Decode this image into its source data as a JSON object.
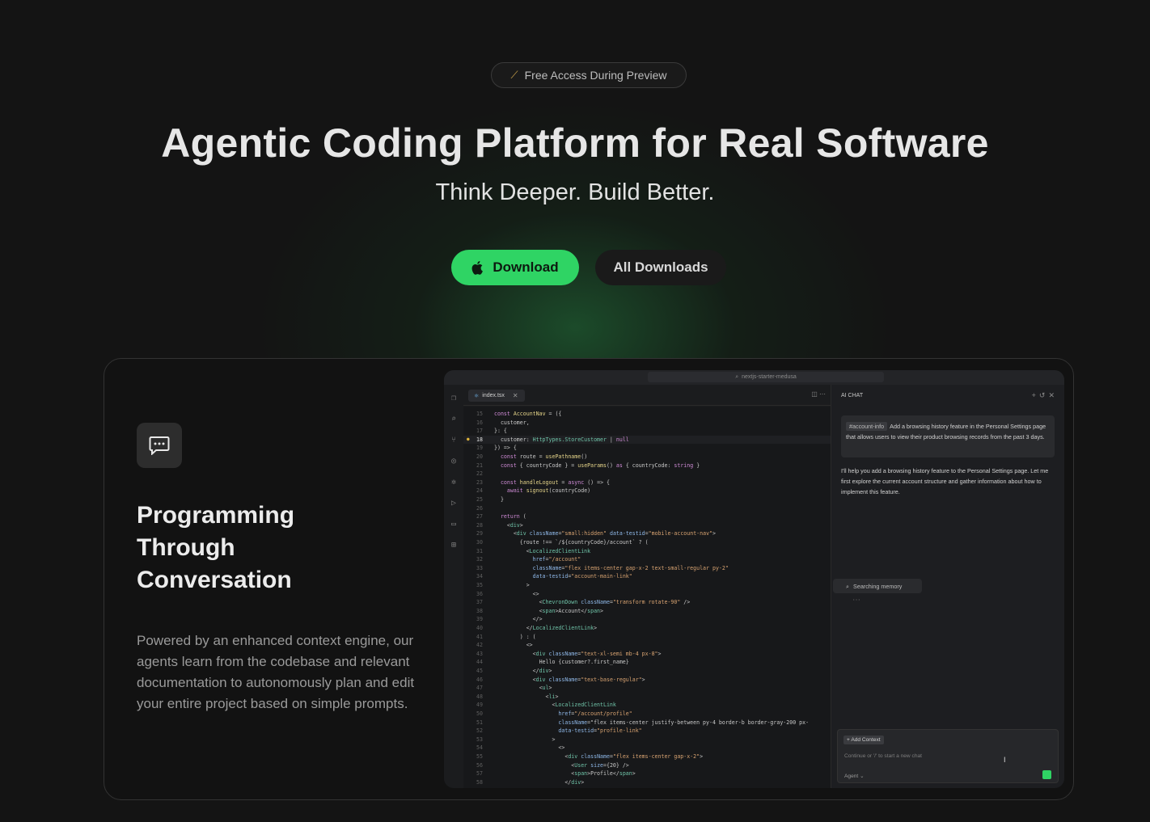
{
  "badge": {
    "icon": "magic-wand-icon",
    "text": "Free Access During Preview"
  },
  "hero": {
    "title": "Agentic Coding Platform for Real Software",
    "subtitle": "Think Deeper. Build Better."
  },
  "buttons": {
    "download": "Download",
    "download_icon": "apple-icon",
    "all_downloads": "All Downloads"
  },
  "colors": {
    "accent": "#2fd464",
    "background": "#141414",
    "card": "#121212"
  },
  "feature": {
    "icon": "chat-bubble-icon",
    "title": "Programming Through Conversation",
    "description": "Powered by an enhanced context engine, our agents learn from the codebase and relevant documentation to autonomously plan and edit your entire project based on simple prompts."
  },
  "ide": {
    "search": "nextjs-starter-medusa",
    "tab": "index.tsx",
    "current_line": 18,
    "code": [
      {
        "n": 15,
        "t": "const AccountNav = ({"
      },
      {
        "n": 16,
        "t": "  customer,"
      },
      {
        "n": 17,
        "t": "}: {"
      },
      {
        "n": 18,
        "t": "  customer: HttpTypes.StoreCustomer | null"
      },
      {
        "n": 19,
        "t": "}) => {"
      },
      {
        "n": 20,
        "t": "  const route = usePathname()"
      },
      {
        "n": 21,
        "t": "  const { countryCode } = useParams() as { countryCode: string }"
      },
      {
        "n": 22,
        "t": ""
      },
      {
        "n": 23,
        "t": "  const handleLogout = async () => {"
      },
      {
        "n": 24,
        "t": "    await signout(countryCode)"
      },
      {
        "n": 25,
        "t": "  }"
      },
      {
        "n": 26,
        "t": ""
      },
      {
        "n": 27,
        "t": "  return ("
      },
      {
        "n": 28,
        "t": "    <div>"
      },
      {
        "n": 29,
        "t": "      <div className=\"small:hidden\" data-testid=\"mobile-account-nav\">"
      },
      {
        "n": 30,
        "t": "        {route !== `/${countryCode}/account` ? ("
      },
      {
        "n": 31,
        "t": "          <LocalizedClientLink"
      },
      {
        "n": 32,
        "t": "            href=\"/account\""
      },
      {
        "n": 33,
        "t": "            className=\"flex items-center gap-x-2 text-small-regular py-2\""
      },
      {
        "n": 34,
        "t": "            data-testid=\"account-main-link\""
      },
      {
        "n": 35,
        "t": "          >"
      },
      {
        "n": 36,
        "t": "            <>"
      },
      {
        "n": 37,
        "t": "              <ChevronDown className=\"transform rotate-90\" />"
      },
      {
        "n": 38,
        "t": "              <span>Account</span>"
      },
      {
        "n": 39,
        "t": "            </>"
      },
      {
        "n": 40,
        "t": "          </LocalizedClientLink>"
      },
      {
        "n": 41,
        "t": "        ) : ("
      },
      {
        "n": 42,
        "t": "          <>"
      },
      {
        "n": 43,
        "t": "            <div className=\"text-xl-semi mb-4 px-8\">"
      },
      {
        "n": 44,
        "t": "              Hello {customer?.first_name}"
      },
      {
        "n": 45,
        "t": "            </div>"
      },
      {
        "n": 46,
        "t": "            <div className=\"text-base-regular\">"
      },
      {
        "n": 47,
        "t": "              <ul>"
      },
      {
        "n": 48,
        "t": "                <li>"
      },
      {
        "n": 49,
        "t": "                  <LocalizedClientLink"
      },
      {
        "n": 50,
        "t": "                    href=\"/account/profile\""
      },
      {
        "n": 51,
        "t": "                    className=\"flex items-center justify-between py-4 border-b border-gray-200 px-"
      },
      {
        "n": 52,
        "t": "                    data-testid=\"profile-link\""
      },
      {
        "n": 53,
        "t": "                  >"
      },
      {
        "n": 54,
        "t": "                    <>"
      },
      {
        "n": 55,
        "t": "                      <div className=\"flex items-center gap-x-2\">"
      },
      {
        "n": 56,
        "t": "                        <User size={20} />"
      },
      {
        "n": 57,
        "t": "                        <span>Profile</span>"
      },
      {
        "n": 58,
        "t": "                      </div>"
      }
    ]
  },
  "chat": {
    "title": "AI CHAT",
    "user_chip": "#account-info",
    "user_message": "Add a browsing history feature in the Personal Settings page that allows users to view their product browsing records from the past 3 days.",
    "ai_message": "I'll help you add a browsing history feature to the Personal Settings page. Let me first explore the current account structure and gather information about how to implement this feature.",
    "status": "Searching memory",
    "add_context": "+ Add Context",
    "placeholder": "Continue or '/' to start a new chat",
    "mode": "Agent"
  }
}
